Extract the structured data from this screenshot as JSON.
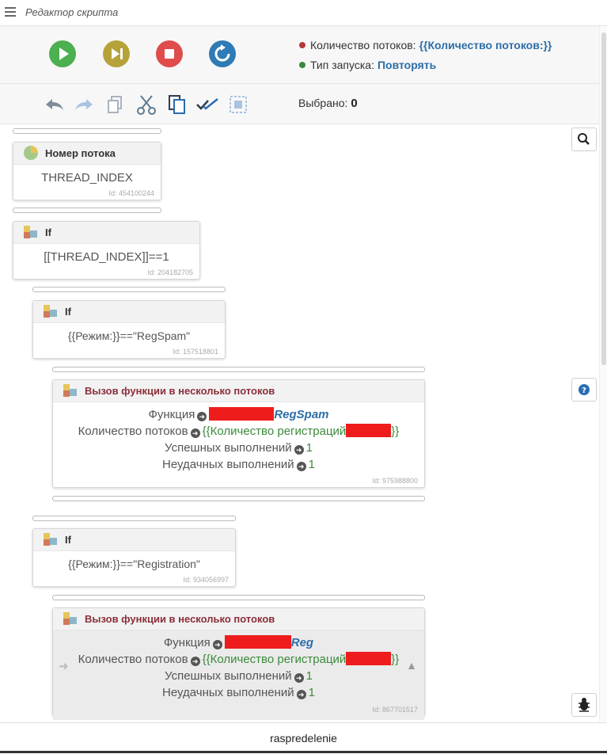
{
  "window": {
    "title": "Редактор скрипта"
  },
  "toolbar": {
    "buttons": [
      {
        "name": "play",
        "color": "#4caf50"
      },
      {
        "name": "step",
        "color": "#b5a33a"
      },
      {
        "name": "stop",
        "color": "#e04b4b"
      },
      {
        "name": "restart",
        "color": "#2e7bb5"
      }
    ],
    "threads_label": "Количество потоков:",
    "threads_value": "{{Количество потоков:}}",
    "threads_dot_color": "#b33a3a",
    "launch_label": "Тип запуска:",
    "launch_value": "Повторять",
    "launch_dot_color": "#3a8a3a"
  },
  "edit_toolbar": {
    "icons": [
      "undo-icon",
      "redo-icon",
      "copy-icon",
      "cut-icon",
      "paste-icon",
      "select-all-icon",
      "select-region-icon"
    ],
    "selected_label": "Выбрано:",
    "selected_count": "0"
  },
  "blocks": [
    {
      "title": "Номер потока",
      "body": "THREAD_INDEX",
      "id": "Id: 454100244"
    },
    {
      "title": "If",
      "body": "[[THREAD_INDEX]]==1",
      "id": "Id: 204182705"
    },
    {
      "title": "If",
      "body": "{{Режим:}}==\"RegSpam\"",
      "id": "Id: 157518801"
    },
    {
      "title": "Вызов функции в несколько потоков",
      "function_label": "Функция",
      "function_value": "RegSpam",
      "threads_label": "Количество потоков",
      "threads_value_prefix": "{{Количество регистраций",
      "threads_value_suffix": "}}",
      "success_label": "Успешных выполнений",
      "success_value": "1",
      "fail_label": "Неудачных выполнений",
      "fail_value": "1",
      "id": "Id: 975988800"
    },
    {
      "title": "If",
      "body": "{{Режим:}}==\"Registration\"",
      "id": "Id: 934056997"
    },
    {
      "title": "Вызов функции в несколько потоков",
      "function_label": "Функция",
      "function_value": "Reg",
      "threads_label": "Количество потоков",
      "threads_value_prefix": "{{Количество регистраций",
      "threads_value_suffix": "}}",
      "success_label": "Успешных выполнений",
      "success_value": "1",
      "fail_label": "Неудачных выполнений",
      "fail_value": "1",
      "id": "Id: 867701517"
    }
  ],
  "side_buttons": [
    "search-icon",
    "help-icon",
    "bug-icon"
  ],
  "footer": {
    "label": "raspredelenie"
  }
}
